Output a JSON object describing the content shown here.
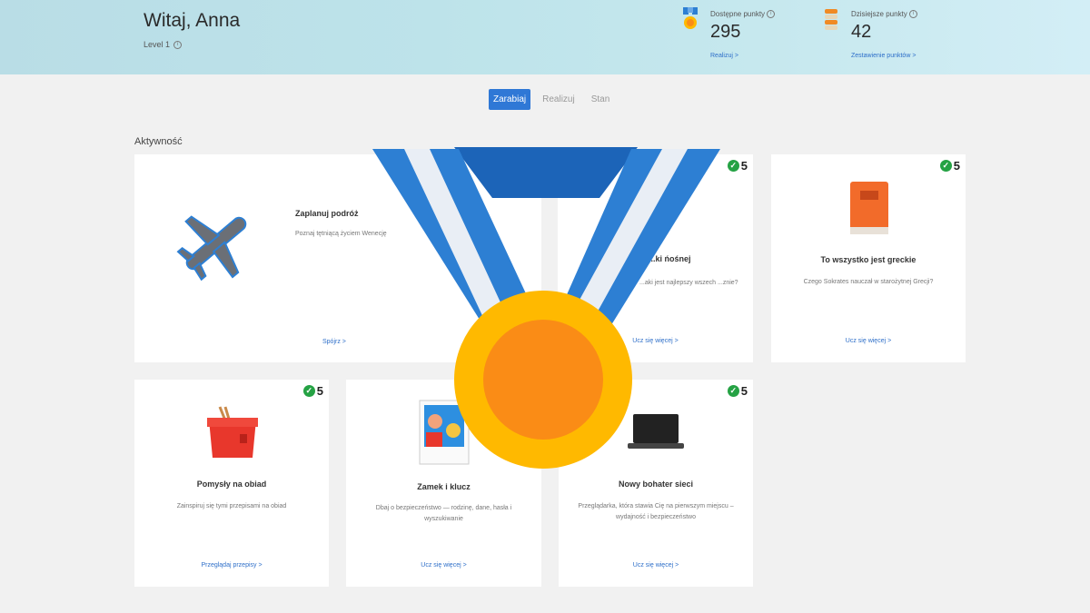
{
  "header": {
    "greeting": "Witaj, Anna",
    "level": "Level 1",
    "available": {
      "label": "Dostępne punkty",
      "value": "295",
      "link": "Realizuj >"
    },
    "today": {
      "label": "Dzisiejsze punkty",
      "value": "42",
      "link": "Zestawienie punktów >"
    }
  },
  "tabs": [
    {
      "label": "Zarabiaj",
      "active": true
    },
    {
      "label": "Realizuj",
      "active": false
    },
    {
      "label": "Stan",
      "active": false
    }
  ],
  "section_title": "Aktywność",
  "cards": [
    {
      "title": "Zaplanuj podróż",
      "desc": "Poznaj tętniącą życiem Wenecję",
      "link": "Spójrz >",
      "points": ""
    },
    {
      "title": "...ki ńośnej",
      "desc": "...aki jest najlepszy wszech ...znie?",
      "link": "Ucz się więcej >",
      "points": "5"
    },
    {
      "title": "To wszystko jest greckie",
      "desc": "Czego Sokrates nauczał w starożytnej Grecji?",
      "link": "Ucz się więcej >",
      "points": "5"
    },
    {
      "title": "Pomysły na obiad",
      "desc": "Zainspiruj się tymi przepisami na obiad",
      "link": "Przeglądaj przepisy >",
      "points": "5"
    },
    {
      "title": "Zamek i klucz",
      "desc": "Dbaj o bezpieczeństwo — rodzinę, dane, hasła i wyszukiwanie",
      "link": "Ucz się więcej >",
      "points": ""
    },
    {
      "title": "Nowy bohater sieci",
      "desc": "Przeglądarka, która stawia Cię na pierwszym miejscu – wydajność i bezpieczeństwo",
      "link": "Ucz się więcej >",
      "points": "5"
    }
  ],
  "colors": {
    "accent": "#2f78d6",
    "check": "#25a244",
    "medal_gold": "#ffb900",
    "medal_orange": "#fa8c16",
    "ribbon_blue": "#2d7fd3"
  },
  "icons": {
    "available": "medal-points-icon",
    "today": "coin-stack-icon",
    "cards": [
      "airplane-icon",
      "",
      "book-icon",
      "takeout-box-icon",
      "photo-icon",
      "laptop-icon"
    ],
    "overlay": "medal-icon"
  }
}
